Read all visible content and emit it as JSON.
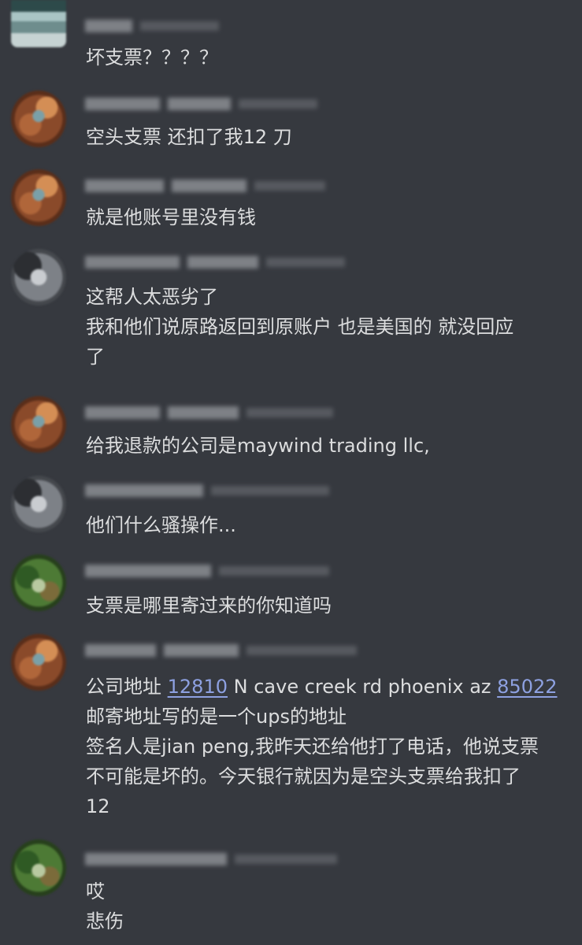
{
  "messages": [
    {
      "lines": [
        [
          "坏支票？？？？"
        ]
      ]
    },
    {
      "lines": [
        [
          "空头支票 还扣了我12 刀"
        ]
      ]
    },
    {
      "lines": [
        [
          "就是他账号里没有钱"
        ]
      ]
    },
    {
      "lines": [
        [
          "这帮人太恶劣了"
        ],
        [
          "我和他们说原路返回到原账户 也是美国的 就没回应"
        ],
        [
          "了"
        ]
      ]
    },
    {
      "lines": [
        [
          "给我退款的公司是maywind trading llc,"
        ]
      ]
    },
    {
      "lines": [
        [
          "他们什么骚操作..."
        ]
      ]
    },
    {
      "lines": [
        [
          "支票是哪里寄过来的你知道吗"
        ]
      ]
    },
    {
      "lines": [
        [
          "公司地址 ",
          "12810",
          " N cave creek rd phoenix az ",
          "85022"
        ],
        [
          "邮寄地址写的是一个ups的地址"
        ],
        [
          "签名人是jian peng,我昨天还给他打了电话，他说支票"
        ],
        [
          "不可能是坏的。今天银行就因为是空头支票给我扣了"
        ],
        [
          "12"
        ]
      ]
    },
    {
      "lines": [
        [
          "哎"
        ],
        [
          "悲伤"
        ]
      ]
    }
  ],
  "colors": {
    "background": "#36393f",
    "text": "#dcddde",
    "link": "#8ea1e1"
  }
}
